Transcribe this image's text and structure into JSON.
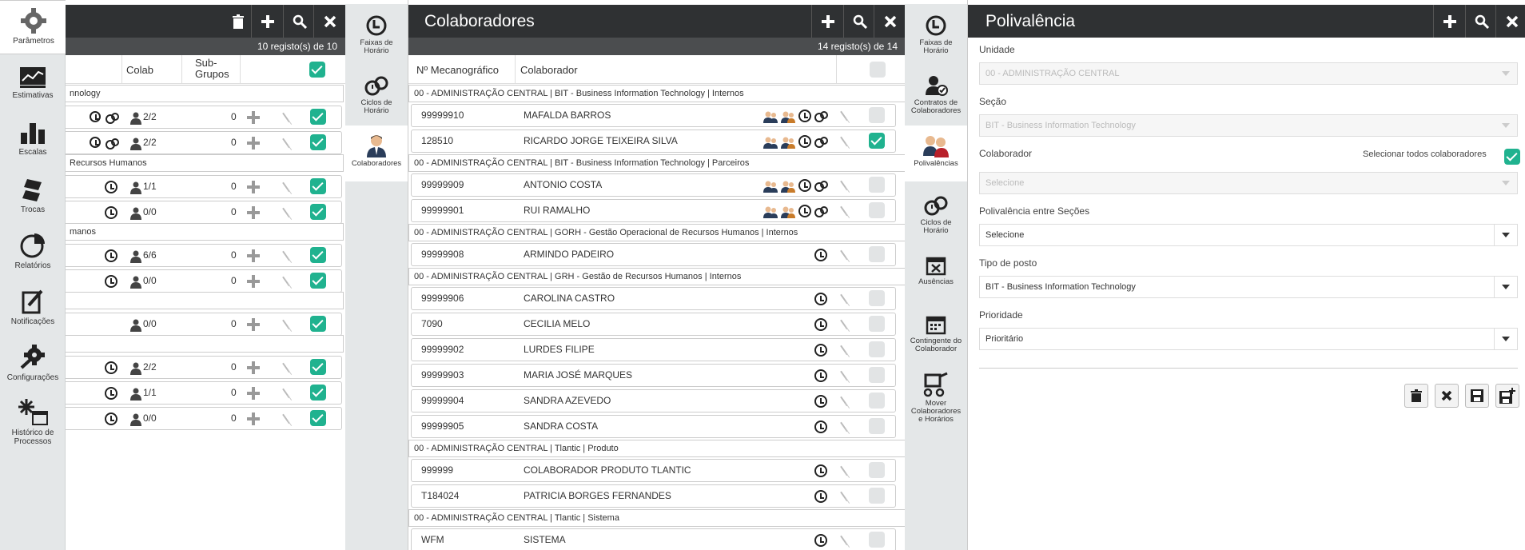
{
  "sidebar": {
    "items": [
      {
        "label": "Parâmetros",
        "icon": "gear-icon",
        "active": true
      },
      {
        "label": "Estimativas",
        "icon": "chart-line-icon"
      },
      {
        "label": "Escalas",
        "icon": "bar-chart-icon"
      },
      {
        "label": "Trocas",
        "icon": "swap-icon"
      },
      {
        "label": "Relatórios",
        "icon": "pie-chart-icon"
      },
      {
        "label": "Notificações",
        "icon": "notification-icon"
      },
      {
        "label": "Configurações",
        "icon": "settings-icon"
      },
      {
        "label": "Histórico de",
        "label2": "Processos",
        "icon": "history-icon"
      }
    ]
  },
  "left_panel": {
    "records": "10  registo(s) de  10",
    "col_colab": "Colab",
    "col_sub": "Sub-",
    "col_sub2": "Grupos",
    "groups": [
      {
        "label": "nnology"
      },
      {
        "label": " Recursos Humanos"
      },
      {
        "label": "manos"
      },
      {
        "label": ""
      },
      {
        "label": ""
      }
    ],
    "rows": [
      {
        "count": "2/2",
        "sub": "0"
      },
      {
        "count": "2/2",
        "sub": "0"
      },
      {
        "count": "1/1",
        "sub": "0"
      },
      {
        "count": "0/0",
        "sub": "0"
      },
      {
        "count": "6/6",
        "sub": "0"
      },
      {
        "count": "0/0",
        "sub": "0"
      },
      {
        "count": "0/0",
        "sub": "0"
      },
      {
        "count": "2/2",
        "sub": "0"
      },
      {
        "count": "1/1",
        "sub": "0"
      },
      {
        "count": "0/0",
        "sub": "0"
      }
    ]
  },
  "tabs1": [
    {
      "label": "Faixas de",
      "label2": "Horário",
      "icon": "clock-icon"
    },
    {
      "label": "Ciclos de",
      "label2": "Horário",
      "icon": "cycle-icon"
    },
    {
      "label": "Colaboradores",
      "label2": "",
      "icon": "user-icon",
      "active": true
    }
  ],
  "middle_panel": {
    "title": "Colaboradores",
    "records": "14  registo(s) de  14",
    "col_num": "Nº Mecanográfico",
    "col_name": "Colaborador",
    "groups": [
      "00 - ADMINISTRAÇÃO CENTRAL | BIT - Business Information Technology | Internos",
      "00 - ADMINISTRAÇÃO CENTRAL | BIT - Business Information Technology | Parceiros",
      "00 - ADMINISTRAÇÃO CENTRAL | GORH - Gestão Operacional de Recursos Humanos | Internos",
      "00 - ADMINISTRAÇÃO CENTRAL | GRH - Gestão de Recursos Humanos | Internos",
      "00 - ADMINISTRAÇÃO CENTRAL | Tlantic | Produto",
      "00 - ADMINISTRAÇÃO CENTRAL | Tlantic | Sistema"
    ],
    "rows": [
      {
        "num": "99999910",
        "name": "MAFALDA BARROS"
      },
      {
        "num": "128510",
        "name": "RICARDO JORGE TEIXEIRA SILVA"
      },
      {
        "num": "99999909",
        "name": "ANTONIO COSTA"
      },
      {
        "num": "99999901",
        "name": "RUI RAMALHO"
      },
      {
        "num": "99999908",
        "name": "ARMINDO PADEIRO"
      },
      {
        "num": "99999906",
        "name": "CAROLINA CASTRO"
      },
      {
        "num": "7090",
        "name": "CECILIA MELO"
      },
      {
        "num": "99999902",
        "name": "LURDES FILIPE"
      },
      {
        "num": "99999903",
        "name": "MARIA JOSÉ MARQUES"
      },
      {
        "num": "99999904",
        "name": "SANDRA AZEVEDO"
      },
      {
        "num": "99999905",
        "name": "SANDRA COSTA"
      },
      {
        "num": "999999",
        "name": "COLABORADOR PRODUTO TLANTIC"
      },
      {
        "num": "T184024",
        "name": "PATRICIA BORGES FERNANDES"
      },
      {
        "num": "WFM",
        "name": "SISTEMA"
      }
    ]
  },
  "tabs2": [
    {
      "label": "Faixas de",
      "label2": "Horário",
      "icon": "clock-icon"
    },
    {
      "label": "Contratos de",
      "label2": "Colaboradores",
      "icon": "contract-icon"
    },
    {
      "label": "Polivalências",
      "label2": "",
      "icon": "team-icon",
      "active": true
    },
    {
      "label": "Ciclos de",
      "label2": "Horário",
      "icon": "cycle-icon"
    },
    {
      "label": "Ausências",
      "label2": "",
      "icon": "calendar-x-icon"
    },
    {
      "label": "Contingente do",
      "label2": "Colaborador",
      "icon": "calendar-icon"
    },
    {
      "label": "Mover",
      "label2": "Colaboradores",
      "label3": "e Horários",
      "icon": "trolley-icon"
    }
  ],
  "right_panel": {
    "title": "Polivalência",
    "unidade_label": "Unidade",
    "unidade_value": "00 - ADMINISTRAÇÃO CENTRAL",
    "secao_label": "Seção",
    "secao_value": "BIT - Business Information Technology",
    "colab_label": "Colaborador",
    "select_all_label": "Selecionar todos colaboradores",
    "colab_value": "Selecione",
    "poli_label": "Polivalência entre Seções",
    "poli_value": "Selecione",
    "tipo_label": "Tipo de posto",
    "tipo_value": "BIT - Business Information Technology",
    "prio_label": "Prioridade",
    "prio_value": "Prioritário"
  },
  "colors": {
    "header": "#2f3133",
    "check": "#20b28f",
    "sidebar": "#e4e7e8"
  }
}
